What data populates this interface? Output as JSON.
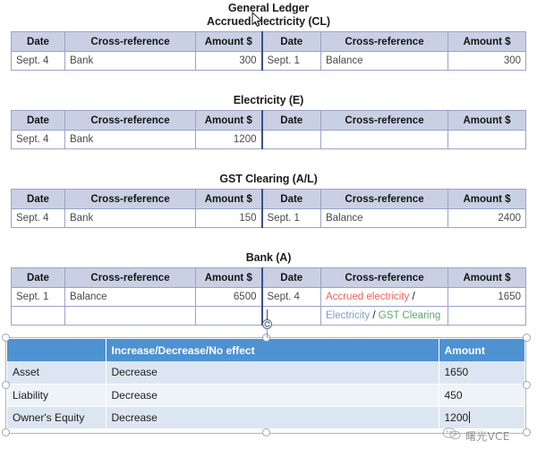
{
  "document": {
    "heading": "General Ledger"
  },
  "ledger": {
    "columns": {
      "date": "Date",
      "cross_reference": "Cross-reference",
      "amount": "Amount $"
    },
    "accounts": [
      {
        "title": "Accrued electricity (CL)",
        "debit_rows": [
          {
            "date": "Sept. 4",
            "cross_reference": "Bank",
            "amount": "300"
          }
        ],
        "credit_rows": [
          {
            "date": "Sept. 1",
            "cross_reference": "Balance",
            "amount": "300"
          }
        ]
      },
      {
        "title": "Electricity (E)",
        "debit_rows": [
          {
            "date": "Sept. 4",
            "cross_reference": "Bank",
            "amount": "1200"
          }
        ],
        "credit_rows": [
          {
            "date": "",
            "cross_reference": "",
            "amount": ""
          }
        ]
      },
      {
        "title": "GST Clearing (A/L)",
        "debit_rows": [
          {
            "date": "Sept. 4",
            "cross_reference": "Bank",
            "amount": "150"
          }
        ],
        "credit_rows": [
          {
            "date": "Sept. 1",
            "cross_reference": "Balance",
            "amount": "2400"
          }
        ]
      },
      {
        "title": "Bank (A)",
        "debit_rows": [
          {
            "date": "Sept. 1",
            "cross_reference": "Balance",
            "amount": "6500"
          },
          {
            "date": "",
            "cross_reference": "",
            "amount": ""
          }
        ],
        "credit_rows": [
          {
            "date": "Sept. 4",
            "cross_reference_parts": [
              {
                "text": "Accrued electricity",
                "color": "red"
              },
              {
                "text": " /",
                "color": "dark"
              }
            ],
            "amount": "1650"
          },
          {
            "date": "",
            "cross_reference_parts": [
              {
                "text": "Electricity",
                "color": "blue"
              },
              {
                "text": " / ",
                "color": "dark"
              },
              {
                "text": "GST Clearing",
                "color": "green"
              }
            ],
            "amount": ""
          }
        ]
      }
    ]
  },
  "effects_table": {
    "headers": [
      "",
      "Increase/Decrease/No effect",
      "Amount"
    ],
    "rows": [
      {
        "item": "Asset",
        "effect": "Decrease",
        "amount": "1650"
      },
      {
        "item": "Liability",
        "effect": "Decrease",
        "amount": "450"
      },
      {
        "item": "Owner's Equity",
        "effect": "Decrease",
        "amount": "1200"
      }
    ]
  },
  "watermark": {
    "text": "曙光VCE",
    "icon": "wechat-icon"
  },
  "colors": {
    "ledger_header_bg": "#c9d0e4",
    "ledger_border": "#7b85b5",
    "effects_header_bg": "#4f92d1",
    "effects_row_odd": "#dce6f2",
    "effects_row_even": "#eef3fa",
    "accent_red": "#e8645c",
    "accent_blue": "#7da0c4",
    "accent_green": "#5aa86f"
  }
}
